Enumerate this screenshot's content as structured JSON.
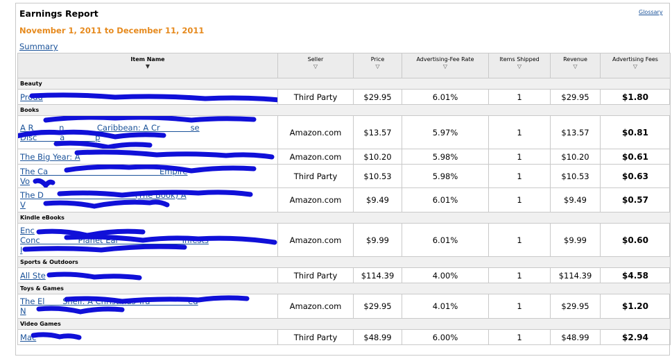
{
  "report": {
    "title": "Earnings Report",
    "glossary_link": "Glossary",
    "date_range": "November 1, 2011 to December 11, 2011",
    "summary_link": "Summary"
  },
  "columns": {
    "item_name": "Item Name",
    "seller": "Seller",
    "price": "Price",
    "fee_rate": "Advertising-Fee Rate",
    "items_shipped": "Items Shipped",
    "revenue": "Revenue",
    "advertising_fees": "Advertising Fees"
  },
  "categories": [
    {
      "name": "Beauty",
      "rows": [
        {
          "item": "Produ",
          "seller": "Third Party",
          "price": "$29.95",
          "rate": "6.01%",
          "shipped": "1",
          "revenue": "$29.95",
          "fees": "$1.80"
        }
      ]
    },
    {
      "name": "Books",
      "rows": [
        {
          "item": "A R          n             Caribbean: A Cr            se\nDisc         a            p",
          "seller": "Amazon.com",
          "price": "$13.57",
          "rate": "5.97%",
          "shipped": "1",
          "revenue": "$13.57",
          "fees": "$0.81"
        },
        {
          "item": "The Big Year: A",
          "seller": "Amazon.com",
          "price": "$10.20",
          "rate": "5.98%",
          "shipped": "1",
          "revenue": "$10.20",
          "fees": "$0.61"
        },
        {
          "item": "The Ca                                            Empire\nVo",
          "seller": "Third Party",
          "price": "$10.53",
          "rate": "5.98%",
          "shipped": "1",
          "revenue": "$10.53",
          "fees": "$0.63"
        },
        {
          "item": "The D                                    (The Book) A\nV",
          "seller": "Amazon.com",
          "price": "$9.49",
          "rate": "6.01%",
          "shipped": "1",
          "revenue": "$9.49",
          "fees": "$0.57"
        }
      ]
    },
    {
      "name": "Kindle eBooks",
      "rows": [
        {
          "item": "Enc\nConc               Planet Ear                         Infests\nI",
          "seller": "Amazon.com",
          "price": "$9.99",
          "rate": "6.01%",
          "shipped": "1",
          "revenue": "$9.99",
          "fees": "$0.60"
        }
      ]
    },
    {
      "name": "Sports & Outdoors",
      "rows": [
        {
          "item": "All Ste",
          "seller": "Third Party",
          "price": "$114.39",
          "rate": "4.00%",
          "shipped": "1",
          "revenue": "$114.39",
          "fees": "$4.58"
        }
      ]
    },
    {
      "name": "Toys & Games",
      "rows": [
        {
          "item": "The El       Shelf: A Christmas Tra               ed\nN",
          "seller": "Amazon.com",
          "price": "$29.95",
          "rate": "4.01%",
          "shipped": "1",
          "revenue": "$29.95",
          "fees": "$1.20"
        }
      ]
    },
    {
      "name": "Video Games",
      "rows": [
        {
          "item": "Mac",
          "seller": "Third Party",
          "price": "$48.99",
          "rate": "6.00%",
          "shipped": "1",
          "revenue": "$48.99",
          "fees": "$2.94"
        }
      ]
    }
  ],
  "colors": {
    "link": "#1a5299",
    "date_accent": "#e68a1e",
    "header_bg": "#ececec",
    "redaction": "#1010d8"
  }
}
